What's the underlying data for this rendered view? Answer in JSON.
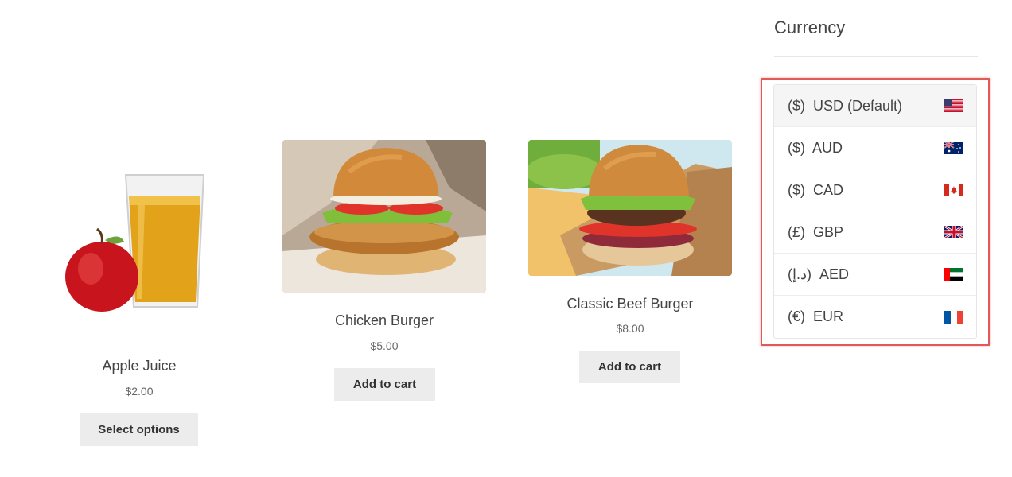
{
  "products": [
    {
      "name": "Apple Juice",
      "price": "$2.00",
      "button": "Select options"
    },
    {
      "name": "Chicken Burger",
      "price": "$5.00",
      "button": "Add to cart"
    },
    {
      "name": "Classic Beef Burger",
      "price": "$8.00",
      "button": "Add to cart"
    }
  ],
  "sidebar": {
    "title": "Currency",
    "currencies": [
      {
        "label": "($)  USD (Default)",
        "flag": "us-flag-icon",
        "active": true
      },
      {
        "label": "($)  AUD",
        "flag": "au-flag-icon"
      },
      {
        "label": "($)  CAD",
        "flag": "ca-flag-icon"
      },
      {
        "label": "(£)  GBP",
        "flag": "gb-flag-icon"
      },
      {
        "label": "(د.إ)  AED",
        "flag": "ae-flag-icon"
      },
      {
        "label": "(€)  EUR",
        "flag": "fr-flag-icon"
      }
    ]
  },
  "colors": {
    "highlight": "#e05a5a",
    "button_bg": "#ececec"
  }
}
